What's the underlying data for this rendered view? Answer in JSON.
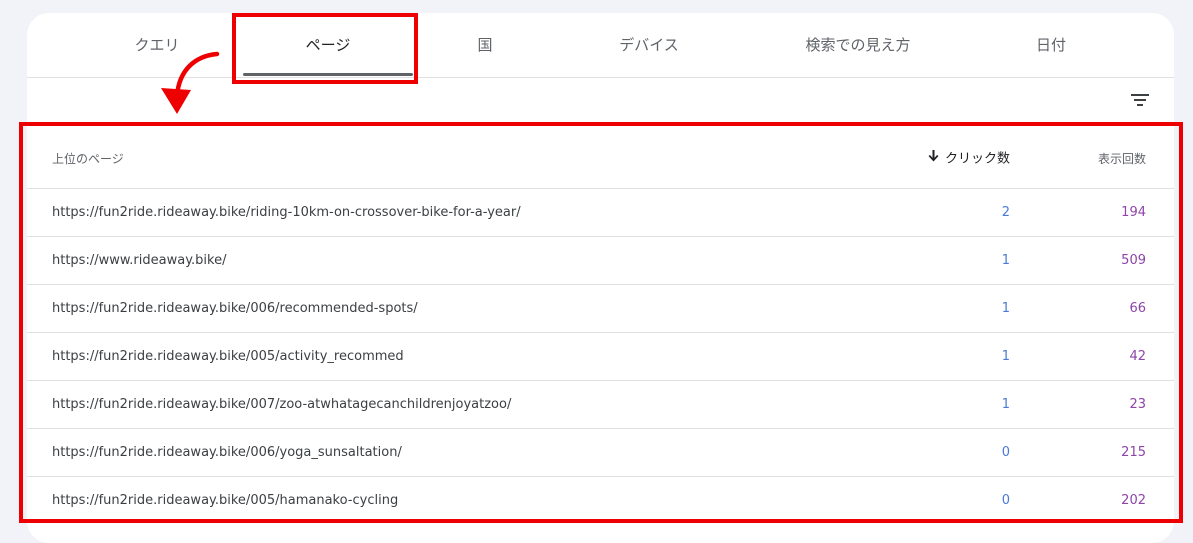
{
  "tabs": [
    {
      "label": "クエリ",
      "active": false
    },
    {
      "label": "ページ",
      "active": true
    },
    {
      "label": "国",
      "active": false
    },
    {
      "label": "デバイス",
      "active": false
    },
    {
      "label": "検索での見え方",
      "active": false
    },
    {
      "label": "日付",
      "active": false
    }
  ],
  "table": {
    "headers": {
      "page": "上位のページ",
      "clicks": "クリック数",
      "impressions": "表示回数"
    },
    "sort": "clicks-desc",
    "rows": [
      {
        "url": "https://fun2ride.rideaway.bike/riding-10km-on-crossover-bike-for-a-year/",
        "clicks": "2",
        "impressions": "194"
      },
      {
        "url": "https://www.rideaway.bike/",
        "clicks": "1",
        "impressions": "509"
      },
      {
        "url": "https://fun2ride.rideaway.bike/006/recommended-spots/",
        "clicks": "1",
        "impressions": "66"
      },
      {
        "url": "https://fun2ride.rideaway.bike/005/activity_recommed",
        "clicks": "1",
        "impressions": "42"
      },
      {
        "url": "https://fun2ride.rideaway.bike/007/zoo-atwhatagecanchildrenjoyatzoo/",
        "clicks": "1",
        "impressions": "23"
      },
      {
        "url": "https://fun2ride.rideaway.bike/006/yoga_sunsaltation/",
        "clicks": "0",
        "impressions": "215"
      },
      {
        "url": "https://fun2ride.rideaway.bike/005/hamanako-cycling",
        "clicks": "0",
        "impressions": "202"
      }
    ]
  },
  "colors": {
    "annotation": "#ee0000",
    "clicks": "#4a7ad8",
    "impressions": "#8e45a8",
    "background": "#f1f3f9"
  },
  "icons": {
    "filter": "filter-icon",
    "sort": "arrow-down-icon"
  }
}
